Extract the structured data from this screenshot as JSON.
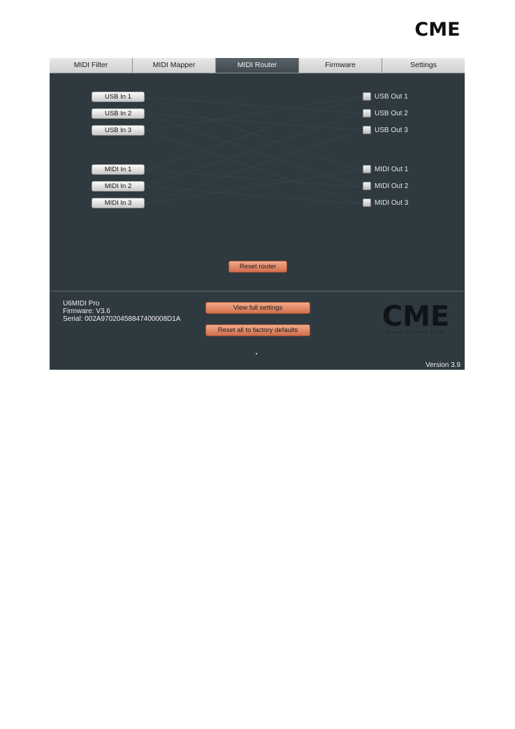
{
  "logo": {
    "text": "CME"
  },
  "tabs": [
    {
      "label": "MIDI Filter",
      "active": false
    },
    {
      "label": "MIDI Mapper",
      "active": false
    },
    {
      "label": "MIDI Router",
      "active": true
    },
    {
      "label": "Firmware",
      "active": false
    },
    {
      "label": "Settings",
      "active": false
    }
  ],
  "router": {
    "inputs": [
      "USB In 1",
      "USB In 2",
      "USB In 3",
      "MIDI In 1",
      "MIDI In 2",
      "MIDI In 3"
    ],
    "outputs": [
      {
        "label": "USB Out 1",
        "checked": false
      },
      {
        "label": "USB Out 2",
        "checked": false
      },
      {
        "label": "USB Out 3",
        "checked": false
      },
      {
        "label": "MIDI Out 1",
        "checked": false
      },
      {
        "label": "MIDI Out 2",
        "checked": false
      },
      {
        "label": "MIDI Out 3",
        "checked": false
      }
    ],
    "reset_label": "Reset router"
  },
  "device": {
    "name": "U6MIDI Pro",
    "firmware": "Firmware: V3.6",
    "serial": "Serial: 002A97020458847400008D1A"
  },
  "actions": {
    "view_settings_label": "View full settings",
    "factory_reset_label": "Reset all to factory defaults"
  },
  "brand": {
    "logo_text": "CME",
    "tagline": "Always One Step Ahead"
  },
  "version": "Version 3.9",
  "colors": {
    "panel": "#2f3a40",
    "accent": "#d87a58",
    "tab_active": "#4b5459"
  }
}
